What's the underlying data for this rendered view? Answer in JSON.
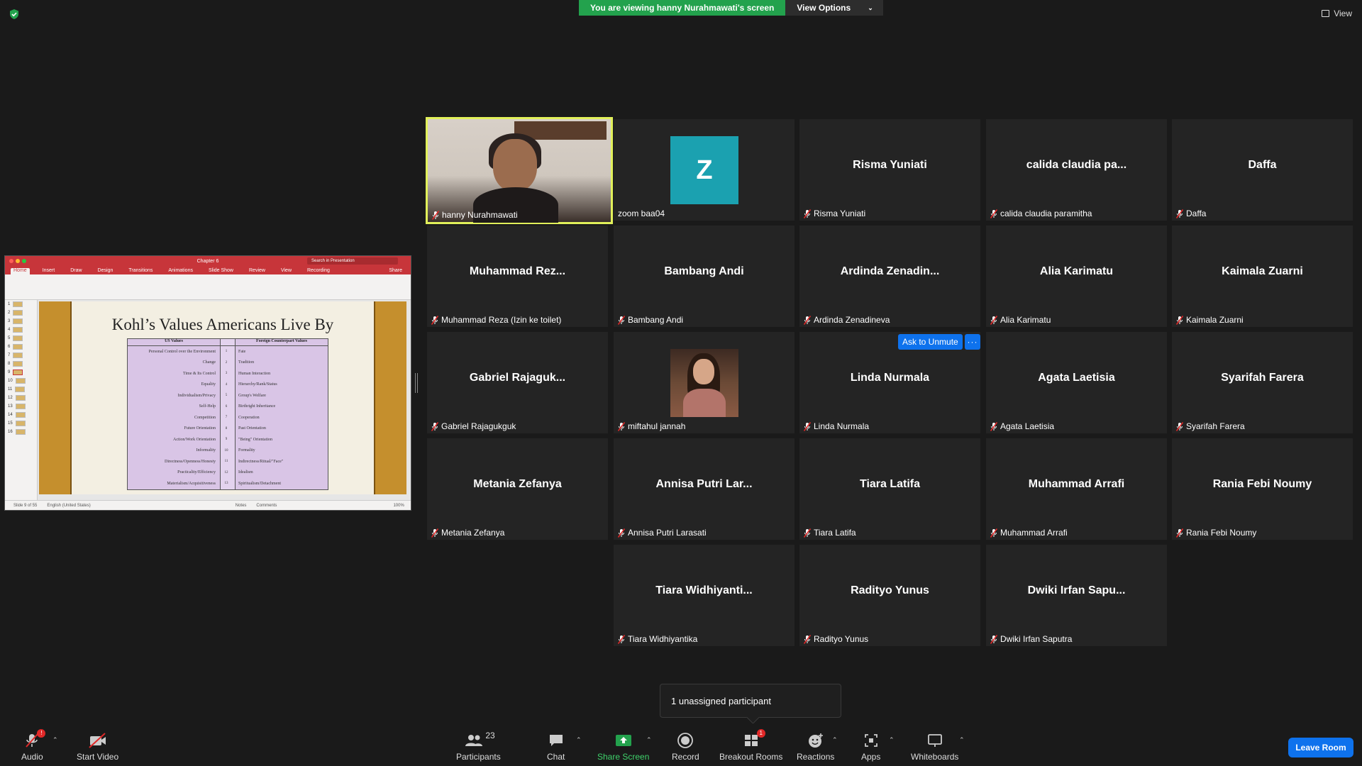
{
  "banner": {
    "viewing_text": "You are viewing hanny Nurahmawati's screen",
    "view_options": "View Options"
  },
  "top_right": {
    "view_label": "View"
  },
  "shared_screen": {
    "app_title": "Chapter 6",
    "search_placeholder": "Search in Presentation",
    "share_label": "Share",
    "ribbon_tabs": [
      "Home",
      "Insert",
      "Draw",
      "Design",
      "Transitions",
      "Animations",
      "Slide Show",
      "Review",
      "View",
      "Recording"
    ],
    "slide_title": "Kohl’s Values Americans Live By",
    "table_headers": [
      "US Values",
      "Foreign Counterpart Values"
    ],
    "table_rows": [
      {
        "us": "Personal Control over the Environment",
        "n": "1",
        "foreign": "Fate"
      },
      {
        "us": "Change",
        "n": "2",
        "foreign": "Tradition"
      },
      {
        "us": "Time & Its Control",
        "n": "3",
        "foreign": "Human Interaction"
      },
      {
        "us": "Equality",
        "n": "4",
        "foreign": "Hierarchy/Rank/Status"
      },
      {
        "us": "Individualism/Privacy",
        "n": "5",
        "foreign": "Group's Welfare"
      },
      {
        "us": "Self-Help",
        "n": "6",
        "foreign": "Birthright Inheritance"
      },
      {
        "us": "Competition",
        "n": "7",
        "foreign": "Cooperation"
      },
      {
        "us": "Future Orientation",
        "n": "8",
        "foreign": "Past Orientation"
      },
      {
        "us": "Action/Work Orientation",
        "n": "9",
        "foreign": "\"Being\" Orientation"
      },
      {
        "us": "Informality",
        "n": "10",
        "foreign": "Formality"
      },
      {
        "us": "Directness/Openness/Honesty",
        "n": "11",
        "foreign": "Indirectness/Ritual/\"Face\""
      },
      {
        "us": "Practicality/Efficiency",
        "n": "12",
        "foreign": "Idealism"
      },
      {
        "us": "Materialism/Acquisitiveness",
        "n": "13",
        "foreign": "Spiritualism/Detachment"
      }
    ],
    "thumb_numbers": [
      "1",
      "2",
      "3",
      "4",
      "5",
      "6",
      "7",
      "8",
      "9",
      "10",
      "11",
      "12",
      "13",
      "14",
      "15",
      "16"
    ],
    "status_slide": "Slide 9 of 55",
    "status_lang": "English (United States)",
    "status_notes": "Notes",
    "status_comments": "Comments",
    "status_zoom": "100%"
  },
  "participants_tiles": [
    {
      "big": "",
      "label": "hanny Nurahmawati",
      "kind": "video",
      "muted": true
    },
    {
      "big": "",
      "label": "zoom baa04",
      "kind": "avatar-z",
      "avatar_letter": "Z",
      "muted": false
    },
    {
      "big": "Risma Yuniati",
      "label": "Risma Yuniati",
      "muted": true
    },
    {
      "big": "calida claudia pa...",
      "label": "calida claudia paramitha",
      "muted": true
    },
    {
      "big": "Daffa",
      "label": "Daffa",
      "muted": true
    },
    {
      "big": "Muhammad  Rez...",
      "label": "Muhammad Reza (Izin ke toilet)",
      "muted": true
    },
    {
      "big": "Bambang Andi",
      "label": "Bambang Andi",
      "muted": true
    },
    {
      "big": "Ardinda  Zenadin...",
      "label": "Ardinda Zenadineva",
      "muted": true
    },
    {
      "big": "Alia Karimatu",
      "label": "Alia Karimatu",
      "muted": true
    },
    {
      "big": "Kaimala Zuarni",
      "label": "Kaimala Zuarni",
      "muted": true
    },
    {
      "big": "Gabriel  Rajaguk...",
      "label": "Gabriel Rajagukguk",
      "muted": true
    },
    {
      "big": "",
      "label": "miftahul jannah",
      "kind": "avatar-photo",
      "muted": true
    },
    {
      "big": "Linda Nurmala",
      "label": "Linda Nurmala",
      "muted": true
    },
    {
      "big": "Agata Laetisia",
      "label": "Agata Laetisia",
      "muted": true
    },
    {
      "big": "Syarifah Farera",
      "label": "Syarifah Farera",
      "muted": true
    },
    {
      "big": "Metania Zefanya",
      "label": "Metania Zefanya",
      "muted": true
    },
    {
      "big": "Annisa Putri Lar...",
      "label": "Annisa Putri Larasati",
      "muted": true
    },
    {
      "big": "Tiara Latifa",
      "label": "Tiara Latifa",
      "muted": true
    },
    {
      "big": "Muhammad Arrafi",
      "label": "Muhammad Arrafi",
      "muted": true
    },
    {
      "big": "Rania Febi Noumy",
      "label": "Rania Febi Noumy",
      "muted": true
    },
    {
      "big": "Tiara  Widhiyanti...",
      "label": "Tiara Widhiyantika",
      "muted": true
    },
    {
      "big": "Radityo Yunus",
      "label": "Radityo Yunus",
      "muted": true
    },
    {
      "big": "Dwiki Irfan Sapu...",
      "label": "Dwiki Irfan Saputra",
      "muted": true
    }
  ],
  "hover_controls": {
    "ask_to_unmute": "Ask to Unmute",
    "more": "···"
  },
  "tooltip": {
    "text": "1 unassigned participant"
  },
  "toolbar": {
    "audio": "Audio",
    "start_video": "Start Video",
    "participants": "Participants",
    "participants_count": "23",
    "chat": "Chat",
    "share_screen": "Share Screen",
    "record": "Record",
    "breakout_rooms": "Breakout Rooms",
    "breakout_badge": "1",
    "reactions": "Reactions",
    "apps": "Apps",
    "whiteboards": "Whiteboards",
    "leave": "Leave Room",
    "audio_badge": "!"
  },
  "colors": {
    "background": "#1a1a1a",
    "tile": "#242424",
    "banner_green": "#23a24d",
    "active_speaker": "#e1f05a",
    "accent_blue": "#0e72ed",
    "mute_red": "#e02828",
    "share_green": "#3fd26b"
  }
}
